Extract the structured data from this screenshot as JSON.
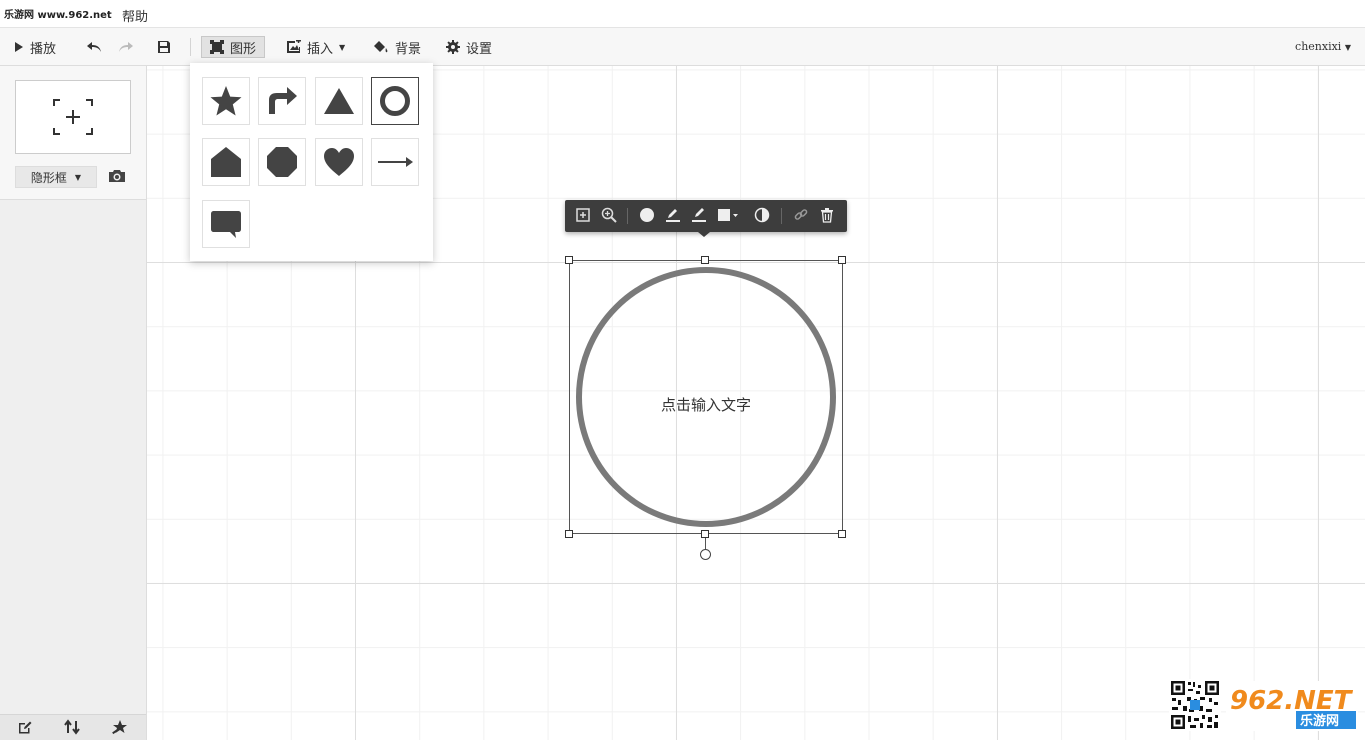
{
  "menubar": {
    "watermark": "乐游网 www.962.net",
    "help": "帮助"
  },
  "toolbar": {
    "play": "播放",
    "shape": "图形",
    "insert": "插入",
    "background": "背景",
    "settings": "设置",
    "user": "chenxixi"
  },
  "sidebar": {
    "frame_type": "隐形框"
  },
  "shape_panel": {
    "shapes": [
      "star-icon",
      "turn-arrow-icon",
      "triangle-icon",
      "ring-icon",
      "pentagon-house-icon",
      "octagon-icon",
      "heart-icon",
      "line-arrow-icon",
      "speech-bubble-icon"
    ],
    "selected": "ring-icon"
  },
  "canvas": {
    "circle_placeholder": "点击输入文字",
    "shape_colors": {
      "stroke": "#7a7a7a",
      "icon_fill": "#444444"
    }
  },
  "logo": {
    "brand": "962.NET",
    "brand_cn": "乐游网"
  }
}
